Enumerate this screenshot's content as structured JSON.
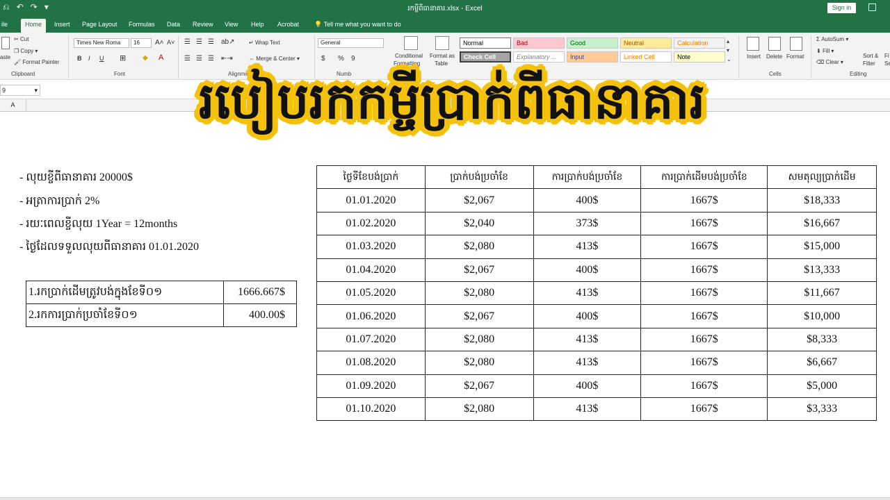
{
  "app": {
    "doc_title": "រកម្លីពីធានាគារ.xlsx  -  Excel",
    "sign_in": "Sign in",
    "qat": [
      "⎌",
      "↶",
      "↷",
      "▾"
    ]
  },
  "tabs": [
    {
      "label": "ile"
    },
    {
      "label": "Home"
    },
    {
      "label": "Insert"
    },
    {
      "label": "Page Layout"
    },
    {
      "label": "Formulas"
    },
    {
      "label": "Data"
    },
    {
      "label": "Review"
    },
    {
      "label": "View"
    },
    {
      "label": "Help"
    },
    {
      "label": "Acrobat"
    },
    {
      "label": "Tell me what you want to do"
    }
  ],
  "ribbon": {
    "clipboard": {
      "cut": "Cut",
      "copy": "Copy",
      "paste": "aste",
      "format_painter": "Format Painter",
      "label": "Clipboard"
    },
    "font": {
      "name": "Times New Roma",
      "size": "16",
      "bold": "B",
      "italic": "I",
      "underline": "U",
      "label": "Font"
    },
    "alignment": {
      "wrap": "Wrap Text",
      "merge": "Merge & Center",
      "label": "Alignment"
    },
    "number": {
      "format": "General",
      "currency": "$",
      "percent": "%",
      "comma": "9",
      "label": "Numb"
    },
    "styles": {
      "conditional": "Conditional",
      "conditional2": "Formatting",
      "format_as": "Format as",
      "format_as2": "Table",
      "cells": [
        {
          "label": "Normal",
          "bg": "#ffffff",
          "fg": "#000000"
        },
        {
          "label": "Bad",
          "bg": "#ffc7ce",
          "fg": "#9c0006"
        },
        {
          "label": "Good",
          "bg": "#c6efce",
          "fg": "#006100"
        },
        {
          "label": "Neutral",
          "bg": "#ffeb9c",
          "fg": "#9c5700"
        },
        {
          "label": "Calculation",
          "bg": "#f2f2f2",
          "fg": "#fa7d00"
        },
        {
          "label": "Check Cell",
          "bg": "#a5a5a5",
          "fg": "#ffffff"
        },
        {
          "label": "Explanatory ...",
          "bg": "#ffffff",
          "fg": "#7f7f7f"
        },
        {
          "label": "Input",
          "bg": "#ffcc99",
          "fg": "#3f3f76"
        },
        {
          "label": "Linked Cell",
          "bg": "#ffffff",
          "fg": "#fa7d00"
        },
        {
          "label": "Note",
          "bg": "#ffffcc",
          "fg": "#000000"
        }
      ]
    },
    "cells_group": {
      "insert": "Insert",
      "delete": "Delete",
      "format": "Format",
      "label": "Cells"
    },
    "editing": {
      "autosum": "AutoSum",
      "fill": "Fill",
      "clear": "Clear",
      "sort": "Sort &",
      "sort2": "Filter",
      "find": "Fi",
      "find2": "Se",
      "label": "Editing"
    }
  },
  "formula_bar": {
    "name_box": "9"
  },
  "sheet": {
    "col_a": "A",
    "banner": "របៀបរកកម្ចីប្រាក់ពីធានាគារ",
    "info": [
      "- លុយខ្ចីពីធានាគារ  20000$",
      "- អត្រាការប្រាក់  2%",
      "- រយៈពេលខ្ចីលុយ 1Year = 12months",
      "- ថ្ងៃដែលទទួលលុយពីធានាគារ 01.01.2020"
    ],
    "calc_rows": [
      {
        "label": "1.រកប្រាក់ដើមត្រូវបង់ក្នុងខែទី០១",
        "value": "1666.667$"
      },
      {
        "label": "2.រកការប្រាក់ប្រចាំខែទី០១",
        "value": "400.00$"
      }
    ],
    "schedule": {
      "headers": [
        "ថ្ងៃទីខែបង់ប្រាក់",
        "ប្រាក់បង់ប្រចាំខែ",
        "ការប្រាក់បង់ប្រចាំខែ",
        "ការប្រាក់ដើមបង់ប្រចាំខែ",
        "សមតុល្យប្រាក់ដើម"
      ],
      "rows": [
        [
          "01.01.2020",
          "$2,067",
          "400$",
          "1667$",
          "$18,333"
        ],
        [
          "01.02.2020",
          "$2,040",
          "373$",
          "1667$",
          "$16,667"
        ],
        [
          "01.03.2020",
          "$2,080",
          "413$",
          "1667$",
          "$15,000"
        ],
        [
          "01.04.2020",
          "$2,067",
          "400$",
          "1667$",
          "$13,333"
        ],
        [
          "01.05.2020",
          "$2,080",
          "413$",
          "1667$",
          "$11,667"
        ],
        [
          "01.06.2020",
          "$2,067",
          "400$",
          "1667$",
          "$10,000"
        ],
        [
          "01.07.2020",
          "$2,080",
          "413$",
          "1667$",
          "$8,333"
        ],
        [
          "01.08.2020",
          "$2,080",
          "413$",
          "1667$",
          "$6,667"
        ],
        [
          "01.09.2020",
          "$2,067",
          "400$",
          "1667$",
          "$5,000"
        ],
        [
          "01.10.2020",
          "$2,080",
          "413$",
          "1667$",
          "$3,333"
        ]
      ]
    }
  }
}
